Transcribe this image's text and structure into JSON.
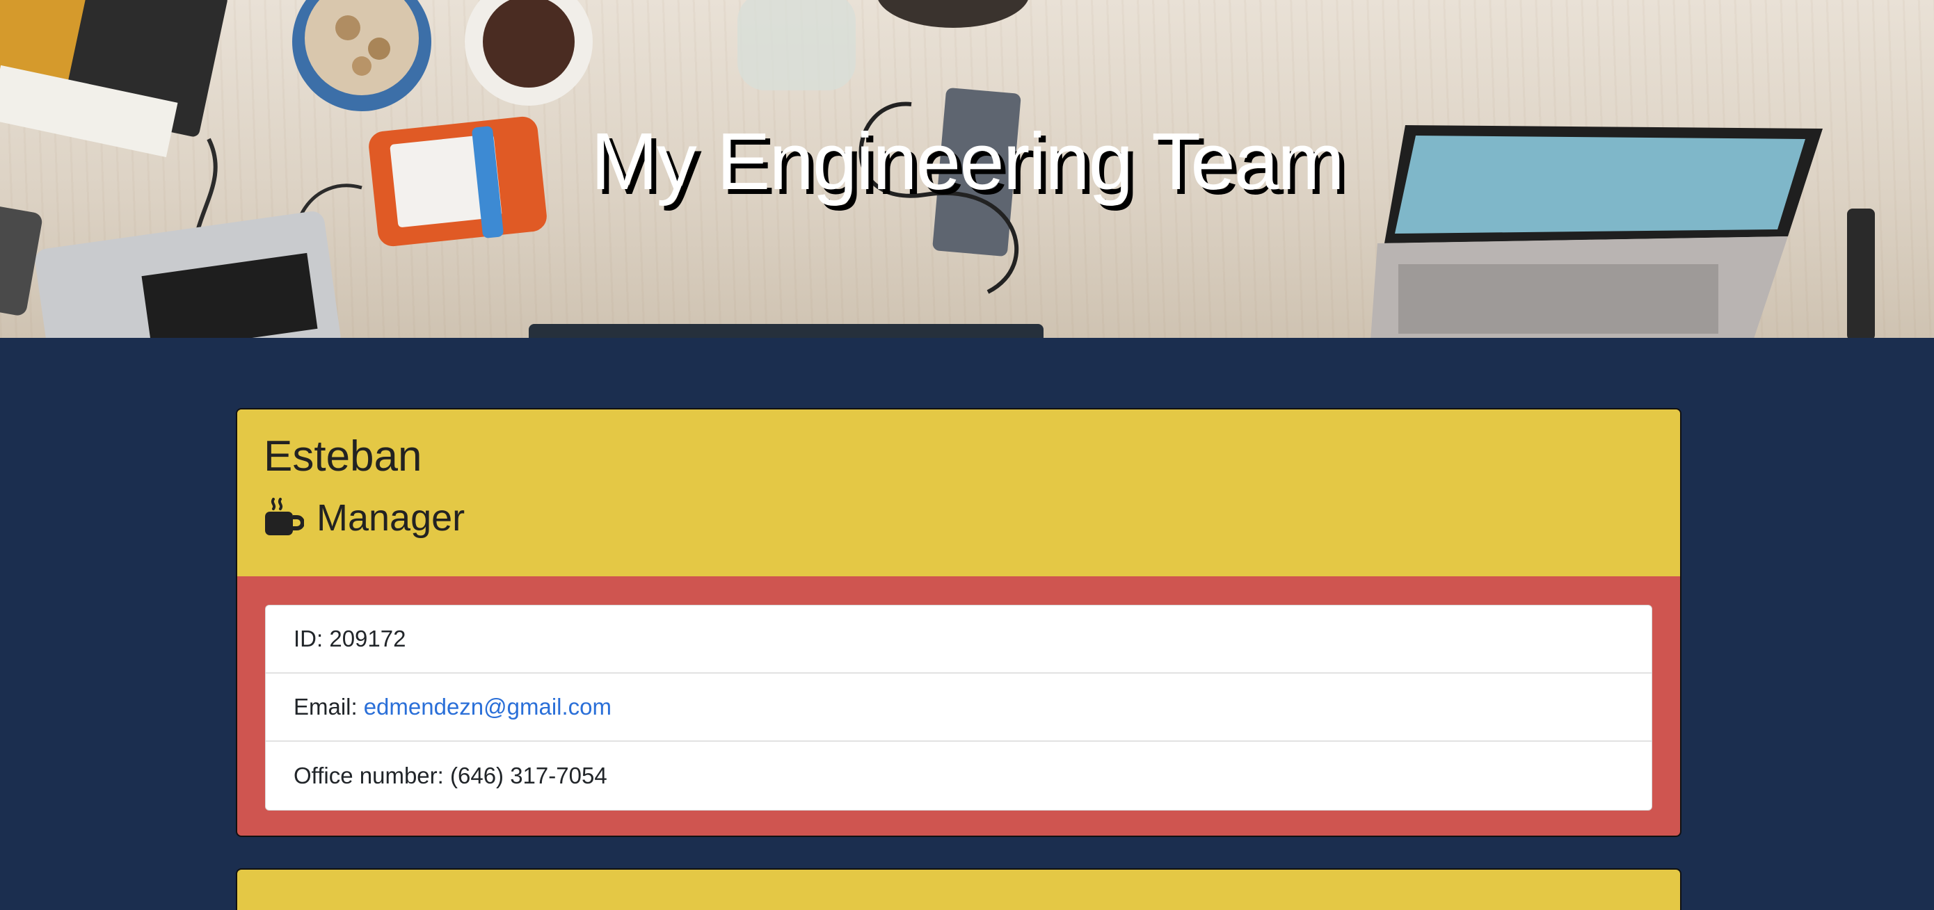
{
  "header": {
    "title": "My Engineering Team"
  },
  "employees": [
    {
      "name": "Esteban",
      "role": "Manager",
      "role_icon": "coffee-mug-icon",
      "id_label": "ID:",
      "id": "209172",
      "email_label": "Email:",
      "email": "edmendezn@gmail.com",
      "office_label": "Office number:",
      "office_number": "(646) 317-7054"
    }
  ],
  "colors": {
    "page_background": "#1b2e4f",
    "card_header": "#e4c845",
    "card_body": "#cf5550",
    "link": "#2a6fd8"
  }
}
